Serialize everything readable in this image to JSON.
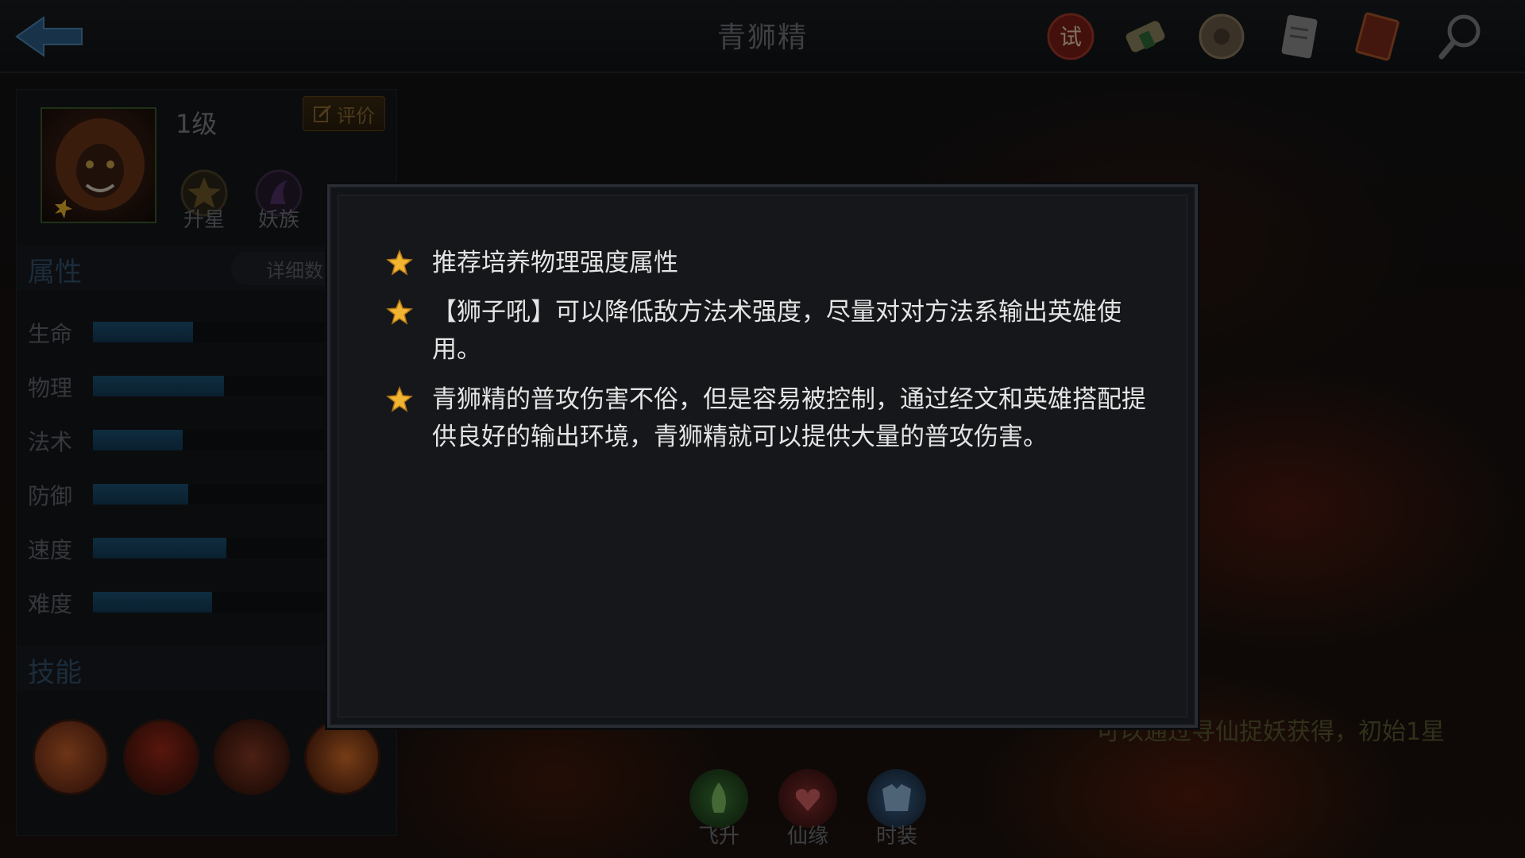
{
  "header": {
    "title": "青狮精",
    "icons": [
      "trial-seal-icon",
      "scroll-icon",
      "coin-icon",
      "document-icon",
      "book-icon",
      "magnifier-icon"
    ]
  },
  "hero": {
    "level": "1级",
    "rate_label": "评价",
    "badges": [
      {
        "label": "升星",
        "icon": "star-badge-icon"
      },
      {
        "label": "妖族",
        "icon": "demon-clan-icon"
      }
    ]
  },
  "attributes": {
    "title": "属性",
    "detail_label": "详细数",
    "stats": [
      {
        "label": "生命",
        "value": 0.34
      },
      {
        "label": "物理",
        "value": 0.445
      },
      {
        "label": "法术",
        "value": 0.305
      },
      {
        "label": "防御",
        "value": 0.325
      },
      {
        "label": "速度",
        "value": 0.455
      },
      {
        "label": "难度",
        "value": 0.405
      }
    ]
  },
  "skills": {
    "title": "技能",
    "icons": [
      "skill-1-icon",
      "skill-2-icon",
      "skill-3-icon",
      "skill-4-icon"
    ]
  },
  "bottom_tabs": [
    {
      "label": "飞升",
      "icon": "ascend-icon",
      "color": "#2f5a2a"
    },
    {
      "label": "仙缘",
      "icon": "fate-icon",
      "color": "#6a2a2a"
    },
    {
      "label": "时装",
      "icon": "costume-icon",
      "color": "#2e4a6a"
    }
  ],
  "source_text": "可以通过寻仙捉妖获得，初始1星",
  "modal": {
    "tips": [
      "推荐培养物理强度属性",
      "【狮子吼】可以降低敌方法术强度，尽量对对方法系输出英雄使用。",
      "青狮精的普攻伤害不俗，但是容易被控制，通过经文和英雄搭配提供良好的输出环境，青狮精就可以提供大量的普攻伤害。"
    ]
  },
  "colors": {
    "accent_blue": "#1d5274",
    "star_gold": "#f2b531",
    "modal_bg": "#15171a"
  }
}
